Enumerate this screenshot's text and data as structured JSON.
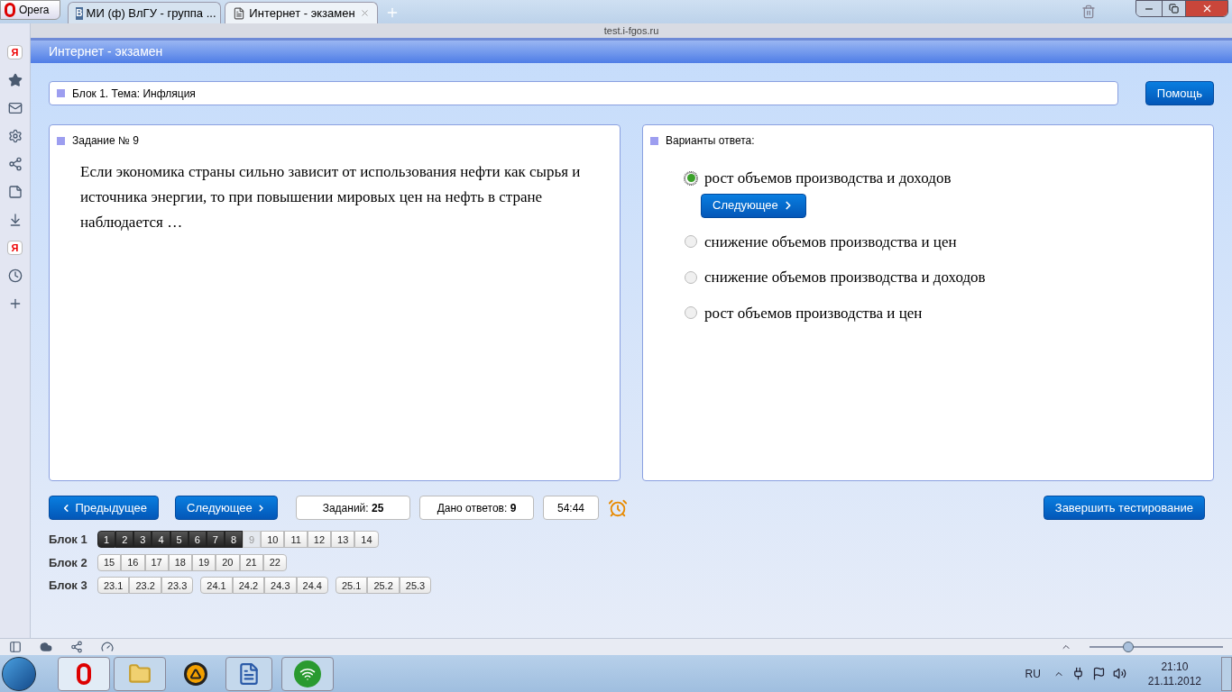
{
  "browser": {
    "menu_label": "Opera",
    "tabs": [
      {
        "kind": "vk",
        "badge": "В",
        "label": "МИ (ф) ВлГУ - группа ...",
        "selected": false
      },
      {
        "kind": "page",
        "label": "Интернет - экзамен",
        "selected": true
      }
    ],
    "address": "test.i-fgos.ru",
    "sidebar": [
      {
        "kind": "yandex",
        "label": "Я"
      },
      {
        "kind": "star"
      },
      {
        "kind": "mail"
      },
      {
        "kind": "gear"
      },
      {
        "kind": "share"
      },
      {
        "kind": "note"
      },
      {
        "kind": "download"
      },
      {
        "kind": "yandex",
        "label": "Я"
      },
      {
        "kind": "clock"
      },
      {
        "kind": "plus"
      }
    ],
    "zoom": {
      "level": 0.29
    }
  },
  "page": {
    "header": "Интернет - экзамен",
    "block_title": "Блок 1. Тема: Инфляция",
    "help_button": "Помощь",
    "task": {
      "title": "Задание № 9",
      "text": "Если экономика страны сильно зависит от использования нефти как сырья и источника энергии, то при повышении мировых цен на нефть в стране наблюдается …"
    },
    "answers": {
      "title": "Варианты ответа:",
      "next_button": "Следующее",
      "options": [
        {
          "label": "рост объемов производства и доходов",
          "selected": true
        },
        {
          "label": "снижение объемов производства и цен",
          "selected": false
        },
        {
          "label": "снижение объемов производства и доходов",
          "selected": false
        },
        {
          "label": "рост объемов производства и цен",
          "selected": false
        }
      ]
    },
    "prev_button": "Предыдущее",
    "next_button": "Следующее",
    "stats": [
      {
        "label": "Заданий:",
        "value": "25"
      },
      {
        "label": "Дано ответов:",
        "value": "9"
      },
      {
        "value": "54:44"
      }
    ],
    "finish_button": "Завершить тестирование",
    "blocks": [
      {
        "label": "Блок 1",
        "groups": [
          {
            "items": [
              {
                "label": "1",
                "answered": true,
                "current": false
              },
              {
                "label": "2",
                "answered": true,
                "current": false
              },
              {
                "label": "3",
                "answered": true,
                "current": false
              },
              {
                "label": "4",
                "answered": true,
                "current": false
              },
              {
                "label": "5",
                "answered": true,
                "current": false
              },
              {
                "label": "6",
                "answered": true,
                "current": false
              },
              {
                "label": "7",
                "answered": true,
                "current": false
              },
              {
                "label": "8",
                "answered": true,
                "current": false
              },
              {
                "label": "9",
                "answered": false,
                "current": true
              },
              {
                "label": "10",
                "answered": false,
                "current": false
              },
              {
                "label": "11",
                "answered": false,
                "current": false
              },
              {
                "label": "12",
                "answered": false,
                "current": false
              },
              {
                "label": "13",
                "answered": false,
                "current": false
              },
              {
                "label": "14",
                "answered": false,
                "current": false
              }
            ]
          }
        ]
      },
      {
        "label": "Блок 2",
        "groups": [
          {
            "items": [
              {
                "label": "15",
                "answered": false,
                "current": false
              },
              {
                "label": "16",
                "answered": false,
                "current": false
              },
              {
                "label": "17",
                "answered": false,
                "current": false
              },
              {
                "label": "18",
                "answered": false,
                "current": false
              },
              {
                "label": "19",
                "answered": false,
                "current": false
              },
              {
                "label": "20",
                "answered": false,
                "current": false
              },
              {
                "label": "21",
                "answered": false,
                "current": false
              },
              {
                "label": "22",
                "answered": false,
                "current": false
              }
            ]
          }
        ]
      },
      {
        "label": "Блок 3",
        "groups": [
          {
            "items": [
              {
                "label": "23.1",
                "answered": false,
                "current": false
              },
              {
                "label": "23.2",
                "answered": false,
                "current": false
              },
              {
                "label": "23.3",
                "answered": false,
                "current": false
              }
            ]
          },
          {
            "items": [
              {
                "label": "24.1",
                "answered": false,
                "current": false
              },
              {
                "label": "24.2",
                "answered": false,
                "current": false
              },
              {
                "label": "24.3",
                "answered": false,
                "current": false
              },
              {
                "label": "24.4",
                "answered": false,
                "current": false
              }
            ]
          },
          {
            "items": [
              {
                "label": "25.1",
                "answered": false,
                "current": false
              },
              {
                "label": "25.2",
                "answered": false,
                "current": false
              },
              {
                "label": "25.3",
                "answered": false,
                "current": false
              }
            ]
          }
        ]
      }
    ]
  },
  "taskbar": {
    "language": "RU",
    "time": "21:10",
    "date": "21.11.2012"
  }
}
